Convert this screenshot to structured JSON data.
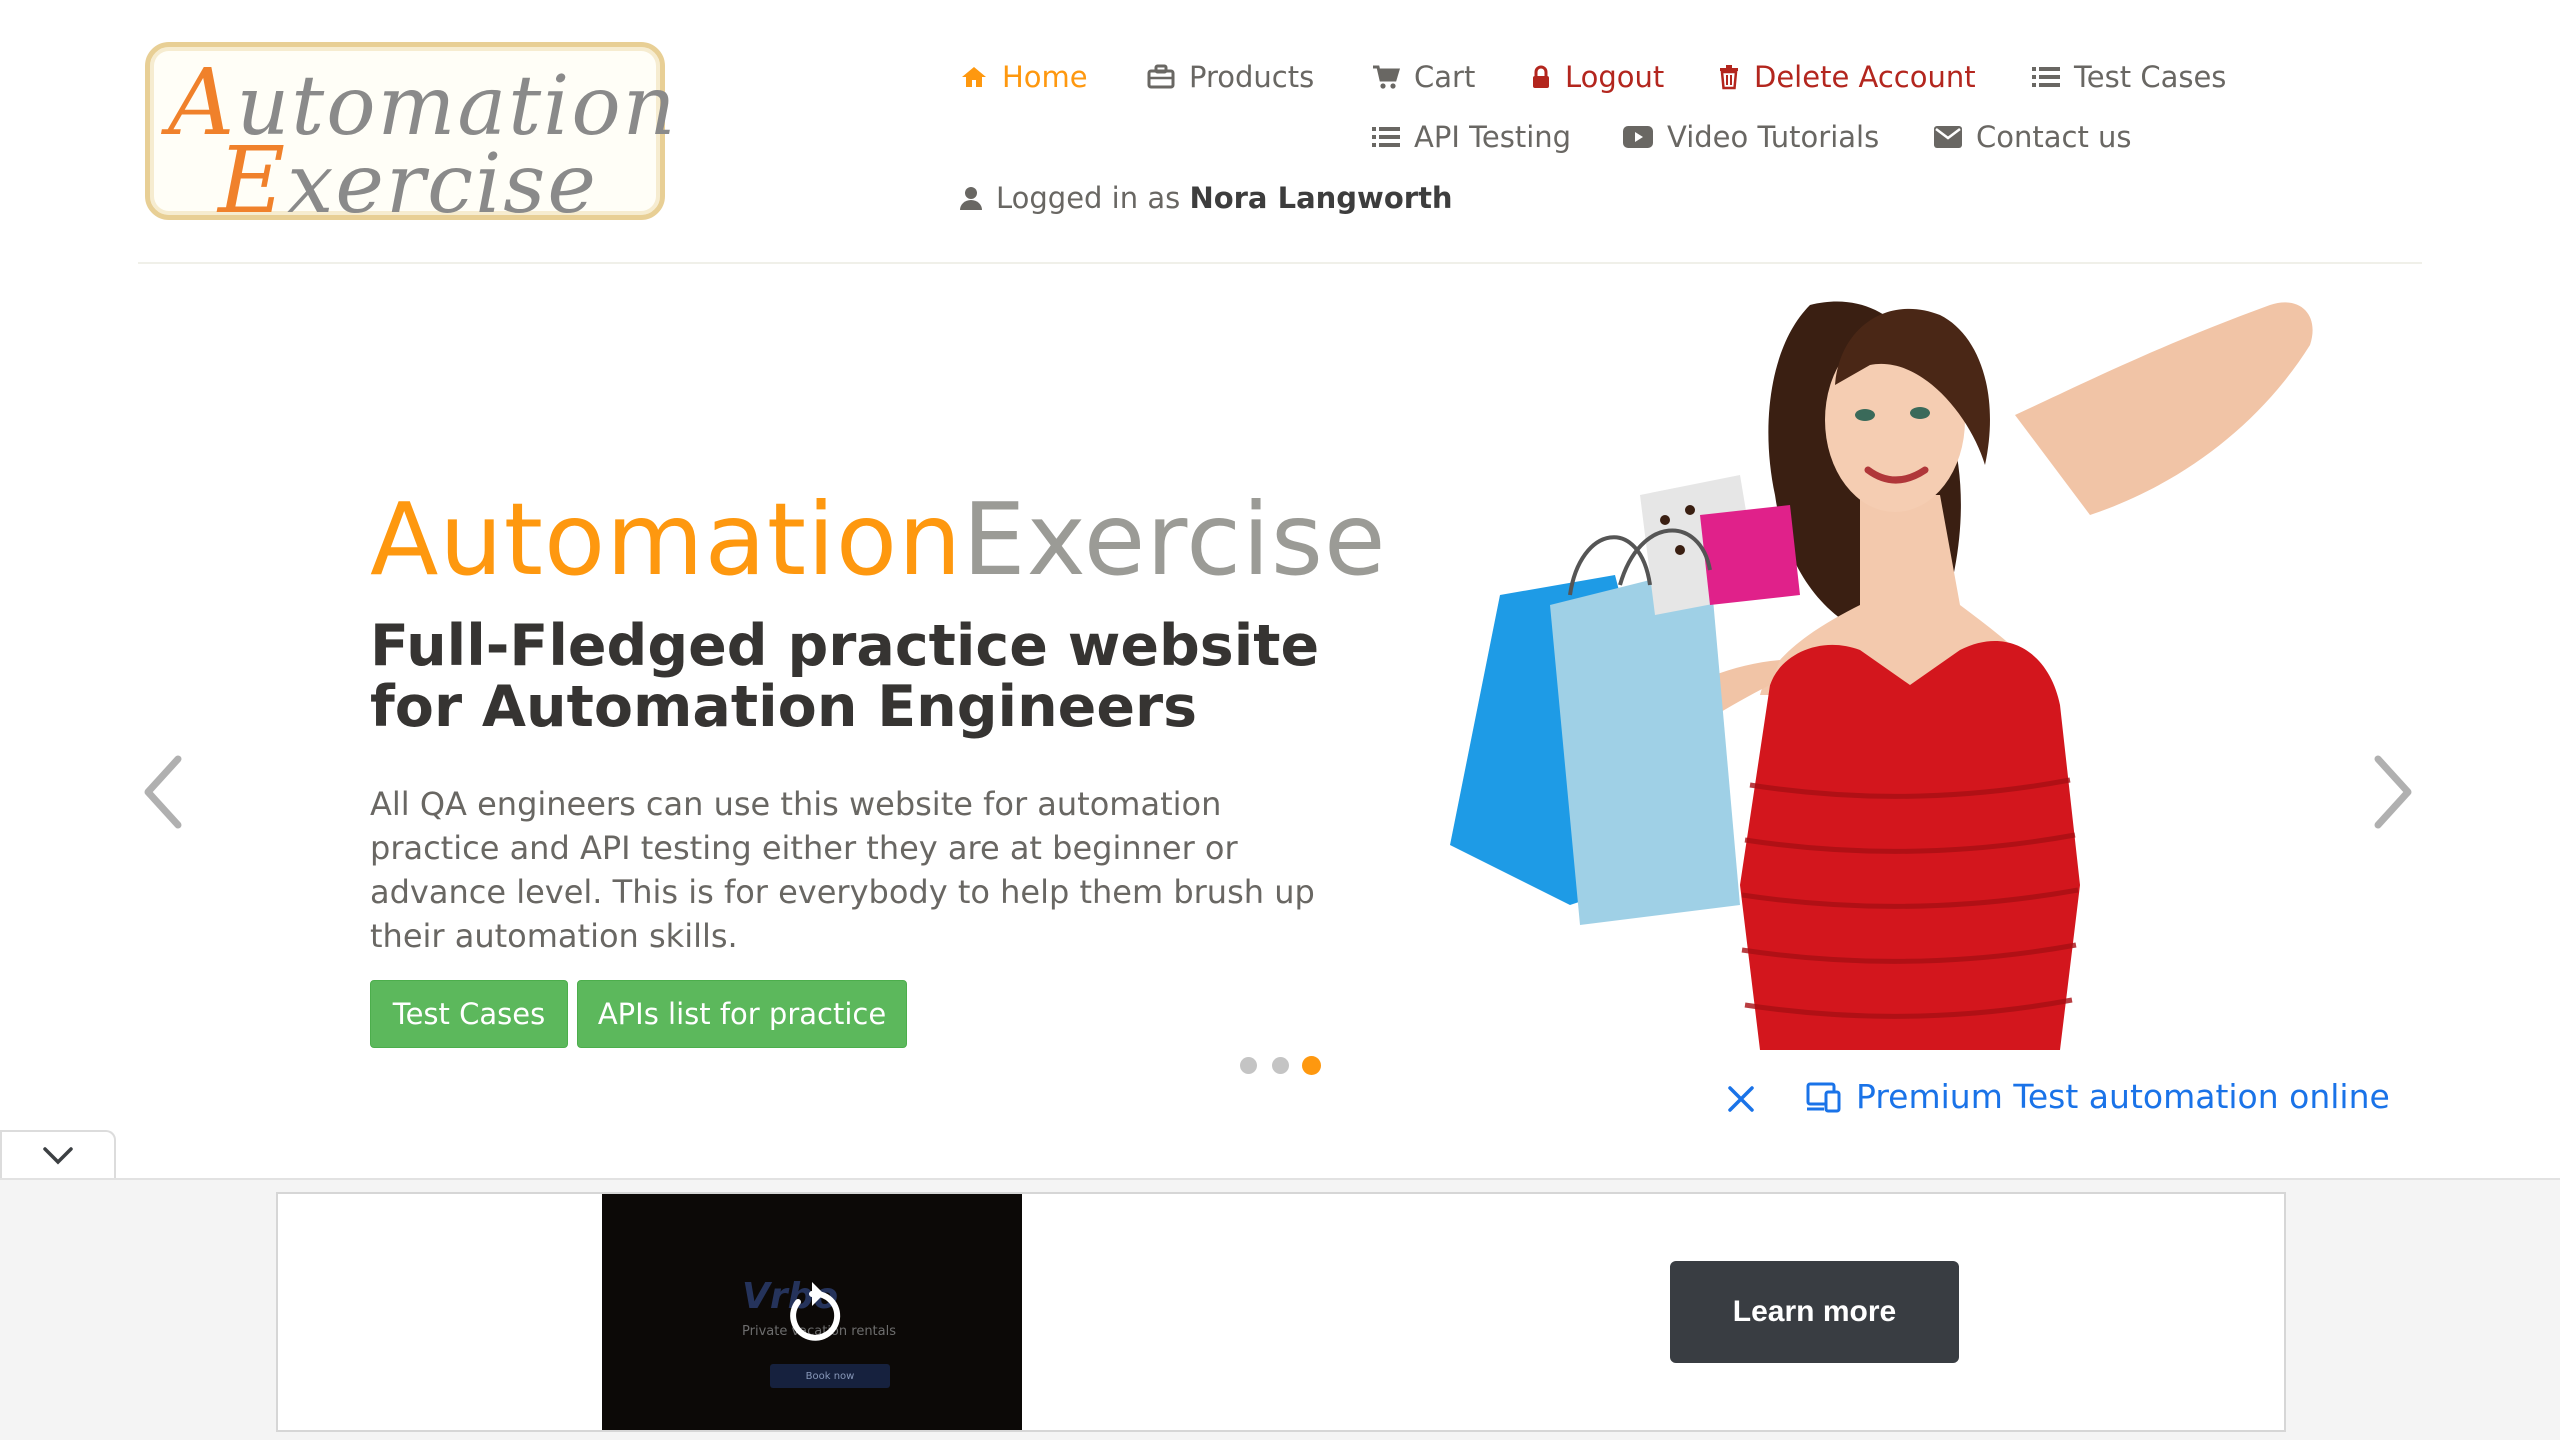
{
  "logo": {
    "line1_cap": "A",
    "line1_rest": "utomation",
    "line2_cap": "E",
    "line2_rest": "xercise"
  },
  "nav": {
    "home": "Home",
    "products": "Products",
    "cart": "Cart",
    "logout": "Logout",
    "delete_account": "Delete Account",
    "test_cases": "Test Cases",
    "api_testing": "API Testing",
    "video_tutorials": "Video Tutorials",
    "contact_us": "Contact us",
    "logged_in_prefix": "Logged in as",
    "username": "Nora Langworth"
  },
  "hero": {
    "title_part1": "Automation",
    "title_part2": "Exercise",
    "subtitle": "Full-Fledged practice website for Automation Engineers",
    "description": "All QA engineers can use this website for automation practice and API testing either they are at beginner or advance level. This is for everybody to help them brush up their automation skills.",
    "button_test_cases": "Test Cases",
    "button_apis": "APIs list for practice",
    "slides_count": 3,
    "active_slide": 3
  },
  "ad": {
    "link_text": "Premium Test automation online",
    "learn_more": "Learn more",
    "video_brand": "Vrbo",
    "video_tagline": "Private vacation rentals",
    "video_cta": "Book now"
  },
  "colors": {
    "brand_orange": "#fe980f",
    "nav_gray": "#696763",
    "danger_red": "#b3261e",
    "button_green": "#5cb85c",
    "ad_link_blue": "#1a73e8",
    "learn_more_bg": "#393d42"
  },
  "icons": {
    "home": "home-icon",
    "products": "briefcase-icon",
    "cart": "shopping-cart-icon",
    "logout": "lock-icon",
    "delete": "trash-icon",
    "list": "list-icon",
    "video": "youtube-play-icon",
    "contact": "envelope-icon",
    "user": "user-icon"
  }
}
